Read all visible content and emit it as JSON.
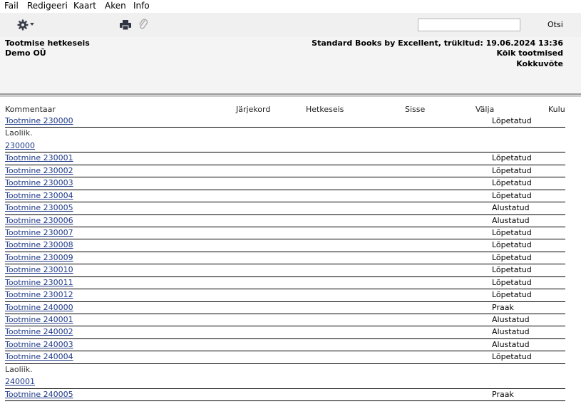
{
  "menu": [
    "Fail",
    "Redigeeri",
    "Kaart",
    "Aken",
    "Info"
  ],
  "toolbar": {
    "search_value": "",
    "search_button": "Otsi"
  },
  "icons": {
    "settings": "gear-icon",
    "print": "printer-icon",
    "attach": "paperclip-icon"
  },
  "report": {
    "title": "Tootmise hetkeseis",
    "company": "Demo OÜ",
    "printed": "Standard Books by Excellent, trükitud: 19.06.2024 13:36",
    "filter": "Kõik tootmised",
    "mode": "Kokkuvõte"
  },
  "columns": [
    "Kommentaar",
    "Järjekord",
    "Hetkeseis",
    "Sisse",
    "Välja",
    "Kulu"
  ],
  "rows": [
    {
      "name": "Tootmine 230000",
      "status": "Lõpetatud"
    },
    {
      "note": "Laoliik.",
      "code": "230000"
    },
    {
      "name": "Tootmine 230001",
      "status": "Lõpetatud"
    },
    {
      "name": "Tootmine 230002",
      "status": "Lõpetatud"
    },
    {
      "name": "Tootmine 230003",
      "status": "Lõpetatud"
    },
    {
      "name": "Tootmine 230004",
      "status": "Lõpetatud"
    },
    {
      "name": "Tootmine 230005",
      "status": "Alustatud"
    },
    {
      "name": "Tootmine 230006",
      "status": "Alustatud"
    },
    {
      "name": "Tootmine 230007",
      "status": "Lõpetatud"
    },
    {
      "name": "Tootmine 230008",
      "status": "Lõpetatud"
    },
    {
      "name": "Tootmine 230009",
      "status": "Lõpetatud"
    },
    {
      "name": "Tootmine 230010",
      "status": "Lõpetatud"
    },
    {
      "name": "Tootmine 230011",
      "status": "Lõpetatud"
    },
    {
      "name": "Tootmine 230012",
      "status": "Lõpetatud"
    },
    {
      "name": "Tootmine 240000",
      "status": "Praak"
    },
    {
      "name": "Tootmine 240001",
      "status": "Alustatud"
    },
    {
      "name": "Tootmine 240002",
      "status": "Alustatud"
    },
    {
      "name": "Tootmine 240003",
      "status": "Alustatud"
    },
    {
      "name": "Tootmine 240004",
      "status": "Lõpetatud"
    },
    {
      "note": "Laoliik.",
      "code": "240001"
    },
    {
      "name": "Tootmine 240005",
      "status": "Praak"
    }
  ],
  "colors": {
    "link": "#1f3a8a",
    "toolbar_bg": "#f0f0f0",
    "header_bg": "#f4f4f4",
    "separator": "#a0a0a0"
  }
}
